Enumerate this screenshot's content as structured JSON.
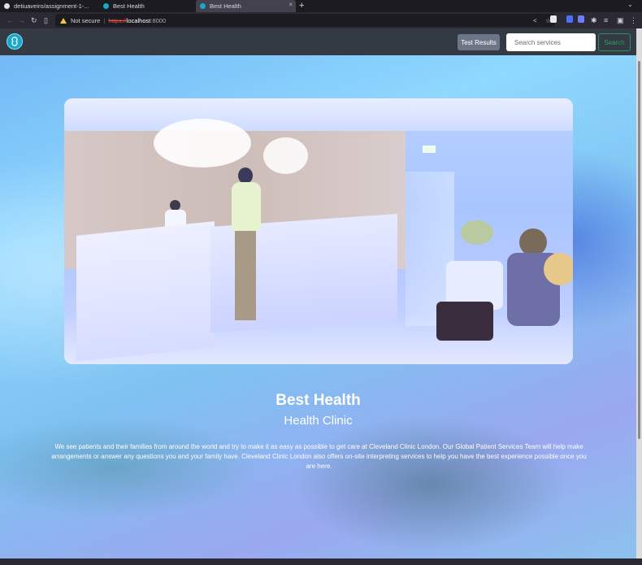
{
  "browser": {
    "tabs": [
      {
        "title": "detiuaveiro/assignment-1-...",
        "icon": "github-icon"
      },
      {
        "title": "Best Health",
        "icon": "site-favicon"
      },
      {
        "title": "Best Health",
        "icon": "site-favicon",
        "active": true
      }
    ],
    "new_tab_glyph": "+",
    "tab_close_glyph": "×",
    "url": {
      "security_text": "Not secure",
      "protocol": "https://",
      "host": "localhost",
      "port": ":8000"
    }
  },
  "site": {
    "nav": {
      "results_label": "Test Results",
      "search_placeholder": "Search services",
      "search_label": "Search"
    },
    "hero": {
      "title": "Best Health",
      "subtitle": "Health Clinic",
      "description": "We see patients and their families from around the world and try to make it as easy as possible to get care at Cleveland Clinic London. Our Global Patient Services Team will help make arrangements or answer any questions you and your family have. Cleveland Clinic London also offers on-site interpreting services to help you have the best experience possible once you are here."
    }
  },
  "colors": {
    "nav_bg": "#333a44",
    "accent_green": "#2e9c62",
    "logo_teal": "#1aa7c9"
  }
}
